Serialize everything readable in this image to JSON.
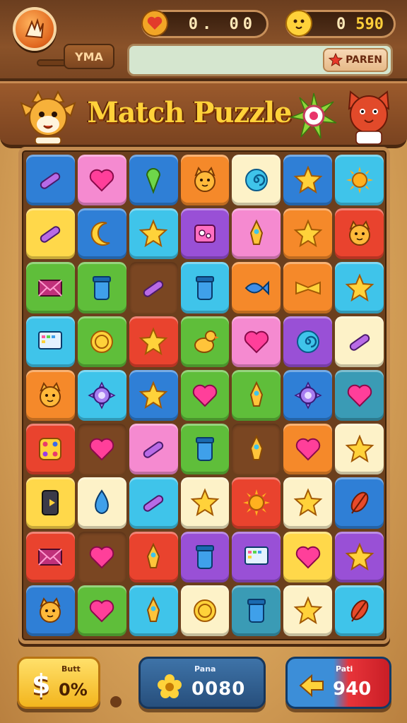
{
  "hud": {
    "left_counter": "0. 00",
    "right_counter_prefix": "0",
    "right_counter_value": "590",
    "signpost": "YMA",
    "pause_label": "PAREN"
  },
  "title": "Match Puzzle",
  "board": {
    "rows": [
      [
        "blue:pen",
        "pink:heart",
        "blue:cone",
        "orange:cat",
        "cream:swirl",
        "blue:star",
        "cyan:sun"
      ],
      [
        "yellow:pen",
        "blue:moon",
        "cyan:star",
        "purple:box",
        "pink:rocket",
        "orange:star",
        "red:cat"
      ],
      [
        "green:envelope",
        "green:jar",
        "empty:pen",
        "cyan:jar",
        "orange:fish",
        "orange:bow",
        "cyan:star"
      ],
      [
        "cyan:screen",
        "green:coin",
        "red:star",
        "green:duck",
        "pink:heart",
        "purple:swirl",
        "cream:pen"
      ],
      [
        "orange:cat",
        "cyan:gear",
        "blue:star",
        "green:heart",
        "green:rocket",
        "blue:gear",
        "teal:heart"
      ],
      [
        "red:dice",
        "empty:heart",
        "pink:pen",
        "green:jar",
        "empty:rocket",
        "orange:heart",
        "cream:star"
      ],
      [
        "yellow:phone",
        "cream:drop",
        "cyan:pen",
        "cream:star",
        "red:sun",
        "cream:star",
        "blue:feather"
      ],
      [
        "red:envelope",
        "empty:heart",
        "red:rocket",
        "purple:jar",
        "purple:screen",
        "yellow:heart",
        "purple:star"
      ],
      [
        "blue:cat",
        "green:heart",
        "cyan:rocket",
        "cream:coin",
        "teal:jar",
        "cream:star",
        "cyan:feather"
      ]
    ]
  },
  "bottom": {
    "coins_small": "Butt",
    "coins_value": "0%",
    "coins_symbol": "$",
    "points_small": "Pana",
    "points_value": "0080",
    "next_small": "Pati",
    "next_value": "940"
  },
  "colors": {
    "blue": "#2f7fd6",
    "pink": "#f58ad0",
    "cyan": "#3fc4ea",
    "orange": "#f5892a",
    "cream": "#fdf2c8",
    "yellow": "#ffd84a",
    "red": "#e9432e",
    "green": "#5fbe3a",
    "purple": "#9950d6",
    "teal": "#3a9bb5",
    "empty": "#7a4622"
  }
}
